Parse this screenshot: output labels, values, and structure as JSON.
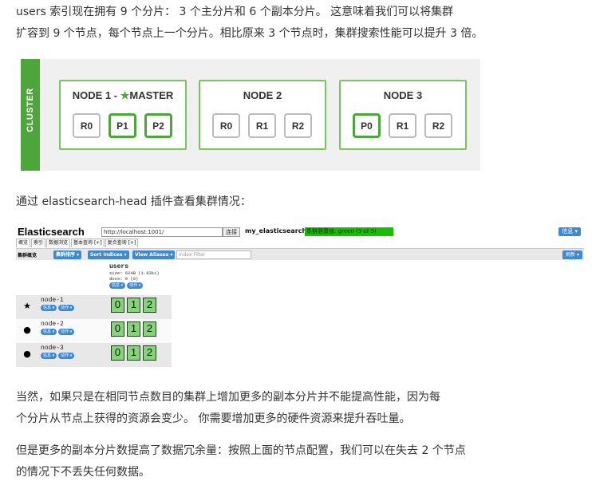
{
  "intro": {
    "line1": "users 索引现在拥有 9 个分片： 3 个主分片和 6 个副本分片。 这意味着我们可以将集群",
    "line2": "扩容到 9 个节点，每个节点上一个分片。相比原来 3 个节点时，集群搜索性能可以提升 3 倍。"
  },
  "diagram": {
    "cluster_label": "CLUSTER",
    "colors": {
      "accent": "#4ea53b",
      "node_border": "#7cc45c",
      "replica_border": "#bbbbbb"
    },
    "nodes": [
      {
        "title": "NODE 1 - ",
        "star": "★",
        "title_suffix": "MASTER",
        "shards": [
          {
            "label": "R0",
            "primary": false
          },
          {
            "label": "P1",
            "primary": true
          },
          {
            "label": "P2",
            "primary": true
          }
        ]
      },
      {
        "title": "NODE 2",
        "star": "",
        "title_suffix": "",
        "shards": [
          {
            "label": "R0",
            "primary": false
          },
          {
            "label": "R1",
            "primary": false
          },
          {
            "label": "R2",
            "primary": false
          }
        ]
      },
      {
        "title": "NODE 3",
        "star": "",
        "title_suffix": "",
        "shards": [
          {
            "label": "P0",
            "primary": true
          },
          {
            "label": "R1",
            "primary": false
          },
          {
            "label": "R2",
            "primary": false
          }
        ]
      }
    ]
  },
  "head_caption": "通过 elasticsearch-head 插件查看集群情况：",
  "es_head": {
    "title": "Elasticsearch",
    "url_value": "http://localhost:1001/",
    "connect_label": "连接",
    "cluster_name": "my_elasticsearch",
    "health_text": "集群健康值: green (9 of 9)",
    "info_label": "信息 ▾",
    "tabs": [
      "概览",
      "索引",
      "数据浏览",
      "基本查询 [+]",
      "复合查询 [+]"
    ],
    "toolbar": {
      "label": "集群概览",
      "sort_label": "集群排序 ▾",
      "sort_indices_label": "Sort Indices ▾",
      "view_aliases_label": "View Aliases ▾",
      "filter_placeholder": "Index Filter",
      "refresh_label": "刷新 ▾"
    },
    "index": {
      "name": "users",
      "size": "size: 624B (1.83ki)",
      "docs": "docs: 0 (0)",
      "info_btn": "信息 ▾",
      "action_btn": "动作 ▾"
    },
    "rows": [
      {
        "icon": "★",
        "icon_name": "master-star-icon",
        "name": "node-1",
        "info_btn": "信息 ▾",
        "action_btn": "动作 ▾",
        "shards": [
          "0",
          "1",
          "2"
        ]
      },
      {
        "icon": "●",
        "icon_name": "node-dot-icon",
        "name": "node-2",
        "info_btn": "信息 ▾",
        "action_btn": "动作 ▾",
        "shards": [
          "0",
          "1",
          "2"
        ]
      },
      {
        "icon": "●",
        "icon_name": "node-dot-icon",
        "name": "node-3",
        "info_btn": "信息 ▾",
        "action_btn": "动作 ▾",
        "shards": [
          "0",
          "1",
          "2"
        ]
      }
    ]
  },
  "outro1": {
    "line1": "当然，如果只是在相同节点数目的集群上增加更多的副本分片并不能提高性能，因为每",
    "line2": "个分片从节点上获得的资源会变少。 你需要增加更多的硬件资源来提升吞吐量。"
  },
  "outro2": {
    "line1": "但是更多的副本分片数提高了数据冗余量：按照上面的节点配置，我们可以在失去 2 个节点",
    "line2": "的情况下不丢失任何数据。"
  }
}
